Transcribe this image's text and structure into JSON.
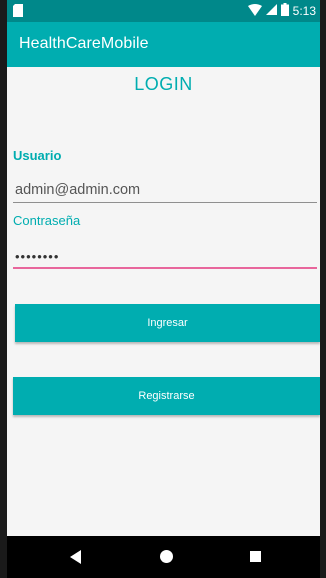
{
  "status_bar": {
    "time": "5:13",
    "icons": [
      "sim-card-icon",
      "wifi-icon",
      "signal-icon",
      "battery-icon"
    ]
  },
  "app_bar": {
    "title": "HealthCareMobile"
  },
  "login": {
    "title": "LOGIN",
    "user_label": "Usuario",
    "user_value": "admin@admin.com",
    "password_label": "Contraseña",
    "password_value": "••••••••",
    "login_button": "Ingresar",
    "register_button": "Registrarse"
  },
  "nav_bar": {
    "icons": [
      "back-icon",
      "home-icon",
      "recents-icon"
    ]
  },
  "colors": {
    "primary": "#00adb0",
    "primary_dark": "#00888a",
    "accent": "#e8669c"
  }
}
